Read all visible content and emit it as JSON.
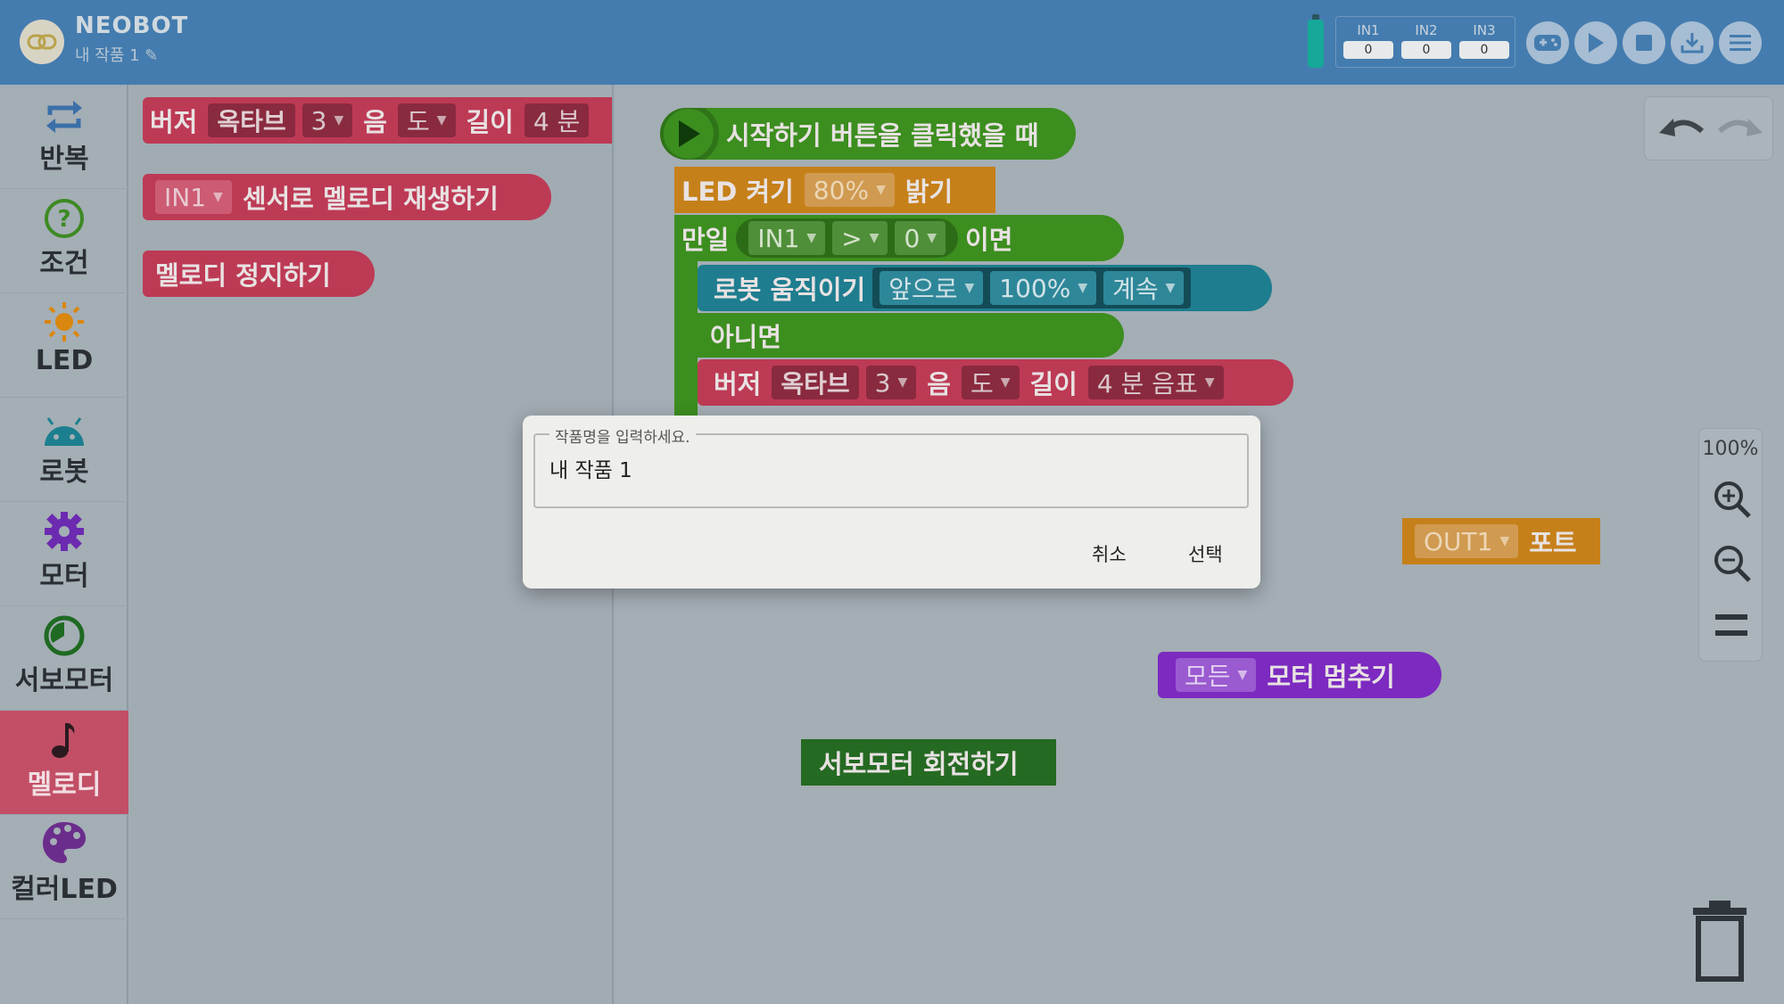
{
  "header": {
    "app_title": "NEOBOT",
    "project_title": "내 작품 1 ✎",
    "inputs": [
      {
        "label": "IN1",
        "value": "0"
      },
      {
        "label": "IN2",
        "value": "0"
      },
      {
        "label": "IN3",
        "value": "0"
      }
    ],
    "buttons": [
      "gamepad-icon",
      "play-icon",
      "stop-icon",
      "download-icon",
      "menu-icon"
    ],
    "battery_color": "#17a899"
  },
  "sidebar": {
    "items": [
      {
        "label": "반복",
        "icon": "repeat-icon"
      },
      {
        "label": "조건",
        "icon": "question-icon"
      },
      {
        "label": "LED",
        "icon": "sun-icon"
      },
      {
        "label": "로봇",
        "icon": "robot-icon"
      },
      {
        "label": "모터",
        "icon": "gear-icon"
      },
      {
        "label": "서보모터",
        "icon": "servo-icon"
      },
      {
        "label": "멜로디",
        "icon": "music-note-icon",
        "active": true
      },
      {
        "label": "컬러LED",
        "icon": "palette-icon"
      }
    ]
  },
  "flyout": {
    "buzzer": {
      "label": "버저",
      "octave_label": "옥타브",
      "octave": "3",
      "note_label": "음",
      "note": "도",
      "length_label": "길이",
      "length": "4 분"
    },
    "sensor_melody": {
      "port": "IN1",
      "label": "센서로 멜로디 재생하기"
    },
    "stop_melody": {
      "label": "멜로디 정지하기"
    }
  },
  "workspace": {
    "start": {
      "label": "시작하기 버튼을 클릭했을 때"
    },
    "led": {
      "label": "LED 켜기",
      "value": "80%",
      "suffix": "밝기"
    },
    "if_block": {
      "label": "만일",
      "port": "IN1",
      "op": ">",
      "value": "0",
      "suffix": "이면"
    },
    "move": {
      "label": "로봇 움직이기",
      "direction": "앞으로",
      "speed": "100%",
      "duration": "계속"
    },
    "else_label": "아니면",
    "buzzer": {
      "label": "버저",
      "octave_label": "옥타브",
      "octave": "3",
      "note_label": "음",
      "note": "도",
      "length_label": "길이",
      "length": "4 분 음표"
    },
    "out_port": {
      "port": "OUT1",
      "label": "포트"
    },
    "motor_stop": {
      "target": "모든",
      "label": "모터 멈추기"
    },
    "servo_rotate": {
      "label": "서보모터 회전하기"
    },
    "zoom": "100%"
  },
  "dialog": {
    "legend": "작품명을 입력하세요.",
    "value": "내 작품 1",
    "cancel": "취소",
    "confirm": "선택"
  },
  "colors": {
    "header": "#447caf",
    "melody_active": "#c24f66",
    "buzzer_block": "#bd3a55",
    "led_block": "#c6801a",
    "control_block": "#3c8e1f",
    "robot_block": "#1e7d8f",
    "motor_block": "#7c2ac0",
    "servo_block": "#256a22"
  }
}
